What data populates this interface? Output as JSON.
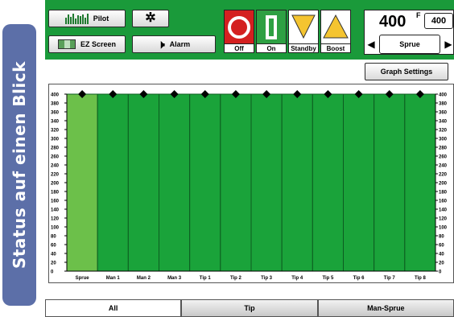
{
  "side_badge": {
    "text": "Status auf einen Blick"
  },
  "toolbar": {
    "pilot_label": "Pilot",
    "ez_screen_label": "EZ Screen",
    "alarm_label": "Alarm",
    "settings_icon": "gear-icon"
  },
  "modes": {
    "off_label": "Off",
    "on_label": "On",
    "standby_label": "Standby",
    "boost_label": "Boost",
    "off_color": "#d42020",
    "on_color": "#2ea043",
    "standby_color": "#f4c430",
    "boost_color": "#f4c430"
  },
  "setpoint": {
    "value": "400",
    "unit": "F",
    "secondary_value": "400",
    "zone_label": "Sprue"
  },
  "graph_settings_label": "Graph Settings",
  "chart_data": {
    "type": "bar",
    "categories": [
      "Sprue",
      "Man 1",
      "Man 2",
      "Man 3",
      "Tip 1",
      "Tip 2",
      "Tip 3",
      "Tip 4",
      "Tip 5",
      "Tip 6",
      "Tip 7",
      "Tip 8"
    ],
    "values": [
      400,
      400,
      400,
      400,
      400,
      400,
      400,
      400,
      400,
      400,
      400,
      400
    ],
    "setpoints": [
      400,
      400,
      400,
      400,
      400,
      400,
      400,
      400,
      400,
      400,
      400,
      400
    ],
    "ylim": [
      0,
      400
    ],
    "yticks": [
      0,
      20,
      40,
      60,
      80,
      100,
      120,
      140,
      160,
      180,
      200,
      220,
      240,
      260,
      280,
      300,
      320,
      340,
      360,
      380,
      400
    ],
    "highlighted_category": "Sprue",
    "bar_color": "#1aa33a",
    "highlight_color": "#6cc04a",
    "marker_color": "#000000"
  },
  "tabs": [
    {
      "label": "All",
      "active": true
    },
    {
      "label": "Tip",
      "active": false
    },
    {
      "label": "Man-Sprue",
      "active": false
    }
  ]
}
